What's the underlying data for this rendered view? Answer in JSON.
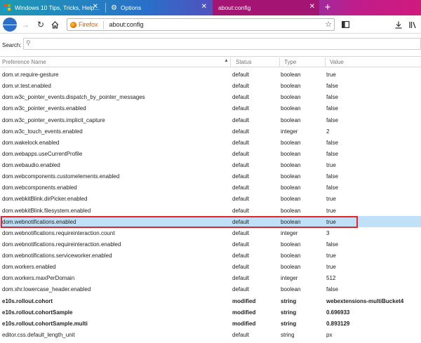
{
  "tabs": [
    {
      "title": "Windows 10 Tips, Tricks, Help...",
      "active": false
    },
    {
      "title": "Options",
      "active": false
    },
    {
      "title": "about:config",
      "active": true
    }
  ],
  "navbar": {
    "brand": "Firefox",
    "url": "about:config"
  },
  "search": {
    "label": "Search:",
    "value": ""
  },
  "columns": [
    "Preference Name",
    "Status",
    "Type",
    "Value"
  ],
  "rows": [
    {
      "name": "dom.vr.require-gesture",
      "status": "default",
      "type": "boolean",
      "value": "true"
    },
    {
      "name": "dom.vr.test.enabled",
      "status": "default",
      "type": "boolean",
      "value": "false"
    },
    {
      "name": "dom.w3c_pointer_events.dispatch_by_pointer_messages",
      "status": "default",
      "type": "boolean",
      "value": "false"
    },
    {
      "name": "dom.w3c_pointer_events.enabled",
      "status": "default",
      "type": "boolean",
      "value": "false"
    },
    {
      "name": "dom.w3c_pointer_events.implicit_capture",
      "status": "default",
      "type": "boolean",
      "value": "false"
    },
    {
      "name": "dom.w3c_touch_events.enabled",
      "status": "default",
      "type": "integer",
      "value": "2"
    },
    {
      "name": "dom.wakelock.enabled",
      "status": "default",
      "type": "boolean",
      "value": "false"
    },
    {
      "name": "dom.webapps.useCurrentProfile",
      "status": "default",
      "type": "boolean",
      "value": "false"
    },
    {
      "name": "dom.webaudio.enabled",
      "status": "default",
      "type": "boolean",
      "value": "true"
    },
    {
      "name": "dom.webcomponents.customelements.enabled",
      "status": "default",
      "type": "boolean",
      "value": "false"
    },
    {
      "name": "dom.webcomponents.enabled",
      "status": "default",
      "type": "boolean",
      "value": "false"
    },
    {
      "name": "dom.webkitBlink.dirPicker.enabled",
      "status": "default",
      "type": "boolean",
      "value": "true"
    },
    {
      "name": "dom.webkitBlink.filesystem.enabled",
      "status": "default",
      "type": "boolean",
      "value": "true"
    },
    {
      "name": "dom.webnotifications.enabled",
      "status": "default",
      "type": "boolean",
      "value": "true",
      "selected": true
    },
    {
      "name": "dom.webnotifications.requireinteraction.count",
      "status": "default",
      "type": "integer",
      "value": "3"
    },
    {
      "name": "dom.webnotifications.requireinteraction.enabled",
      "status": "default",
      "type": "boolean",
      "value": "false"
    },
    {
      "name": "dom.webnotifications.serviceworker.enabled",
      "status": "default",
      "type": "boolean",
      "value": "true"
    },
    {
      "name": "dom.workers.enabled",
      "status": "default",
      "type": "boolean",
      "value": "true"
    },
    {
      "name": "dom.workers.maxPerDomain",
      "status": "default",
      "type": "integer",
      "value": "512"
    },
    {
      "name": "dom.xhr.lowercase_header.enabled",
      "status": "default",
      "type": "boolean",
      "value": "false"
    },
    {
      "name": "e10s.rollout.cohort",
      "status": "modified",
      "type": "string",
      "value": "webextensions-multiBucket4",
      "modified": true
    },
    {
      "name": "e10s.rollout.cohortSample",
      "status": "modified",
      "type": "string",
      "value": "0.696933",
      "modified": true
    },
    {
      "name": "e10s.rollout.cohortSample.multi",
      "status": "modified",
      "type": "string",
      "value": "0.893129",
      "modified": true
    },
    {
      "name": "editor.css.default_length_unit",
      "status": "default",
      "type": "string",
      "value": "px"
    }
  ],
  "colors": {
    "selected_row": "#bfe0f7",
    "highlight_box": "#e0252b",
    "back_button": "#2e6ec7",
    "firefox_brand": "#e66000"
  },
  "icons": [
    "windows-logo-icon",
    "gear-icon",
    "close-icon",
    "plus-icon",
    "back-arrow-icon",
    "forward-arrow-icon",
    "reload-icon",
    "home-icon",
    "firefox-logo-icon",
    "star-icon",
    "sidebar-icon",
    "download-icon",
    "library-icon",
    "search-icon",
    "sort-icon"
  ]
}
